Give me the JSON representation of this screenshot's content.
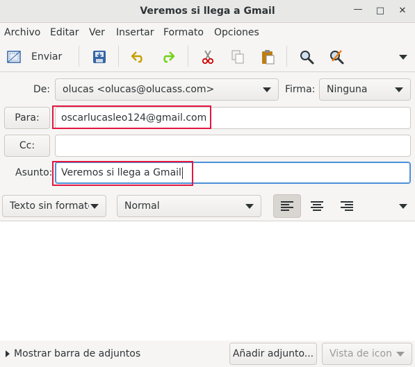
{
  "window": {
    "title": "Veremos si llega a Gmail",
    "minimize_glyph": "—",
    "maximize_glyph": "□",
    "close_glyph": "✕"
  },
  "menu": [
    "Archivo",
    "Editar",
    "Ver",
    "Insertar",
    "Formato",
    "Opciones"
  ],
  "toolbar": {
    "send_label": "Enviar",
    "icons": [
      "send-icon",
      "save-icon",
      "undo-icon",
      "redo-icon",
      "cut-icon",
      "copy-icon",
      "paste-icon",
      "find-icon",
      "spellcheck-icon",
      "overflow-icon"
    ]
  },
  "header": {
    "from_label": "De:",
    "from_value": "olucas <olucas@olucass.com>",
    "signature_label": "Firma:",
    "signature_value": "Ninguna",
    "to_button": "Para:",
    "to_value": "oscarlucasleo124@gmail.com",
    "cc_button": "Cc:",
    "cc_value": "",
    "subject_label": "Asunto:",
    "subject_value": "Veremos si llega a Gmail"
  },
  "format_bar": {
    "text_mode": "Texto sin formato",
    "paragraph_style": "Normal",
    "alignments": [
      "align-left",
      "align-center",
      "align-right"
    ],
    "active_alignment": "align-left"
  },
  "footer": {
    "attachments_toggle": "Mostrar barra de adjuntos",
    "add_attachment": "Añadir adjunto...",
    "view_mode": "Vista de icono"
  },
  "colors": {
    "highlight": "#e3163f",
    "focus": "#4a90d9"
  }
}
